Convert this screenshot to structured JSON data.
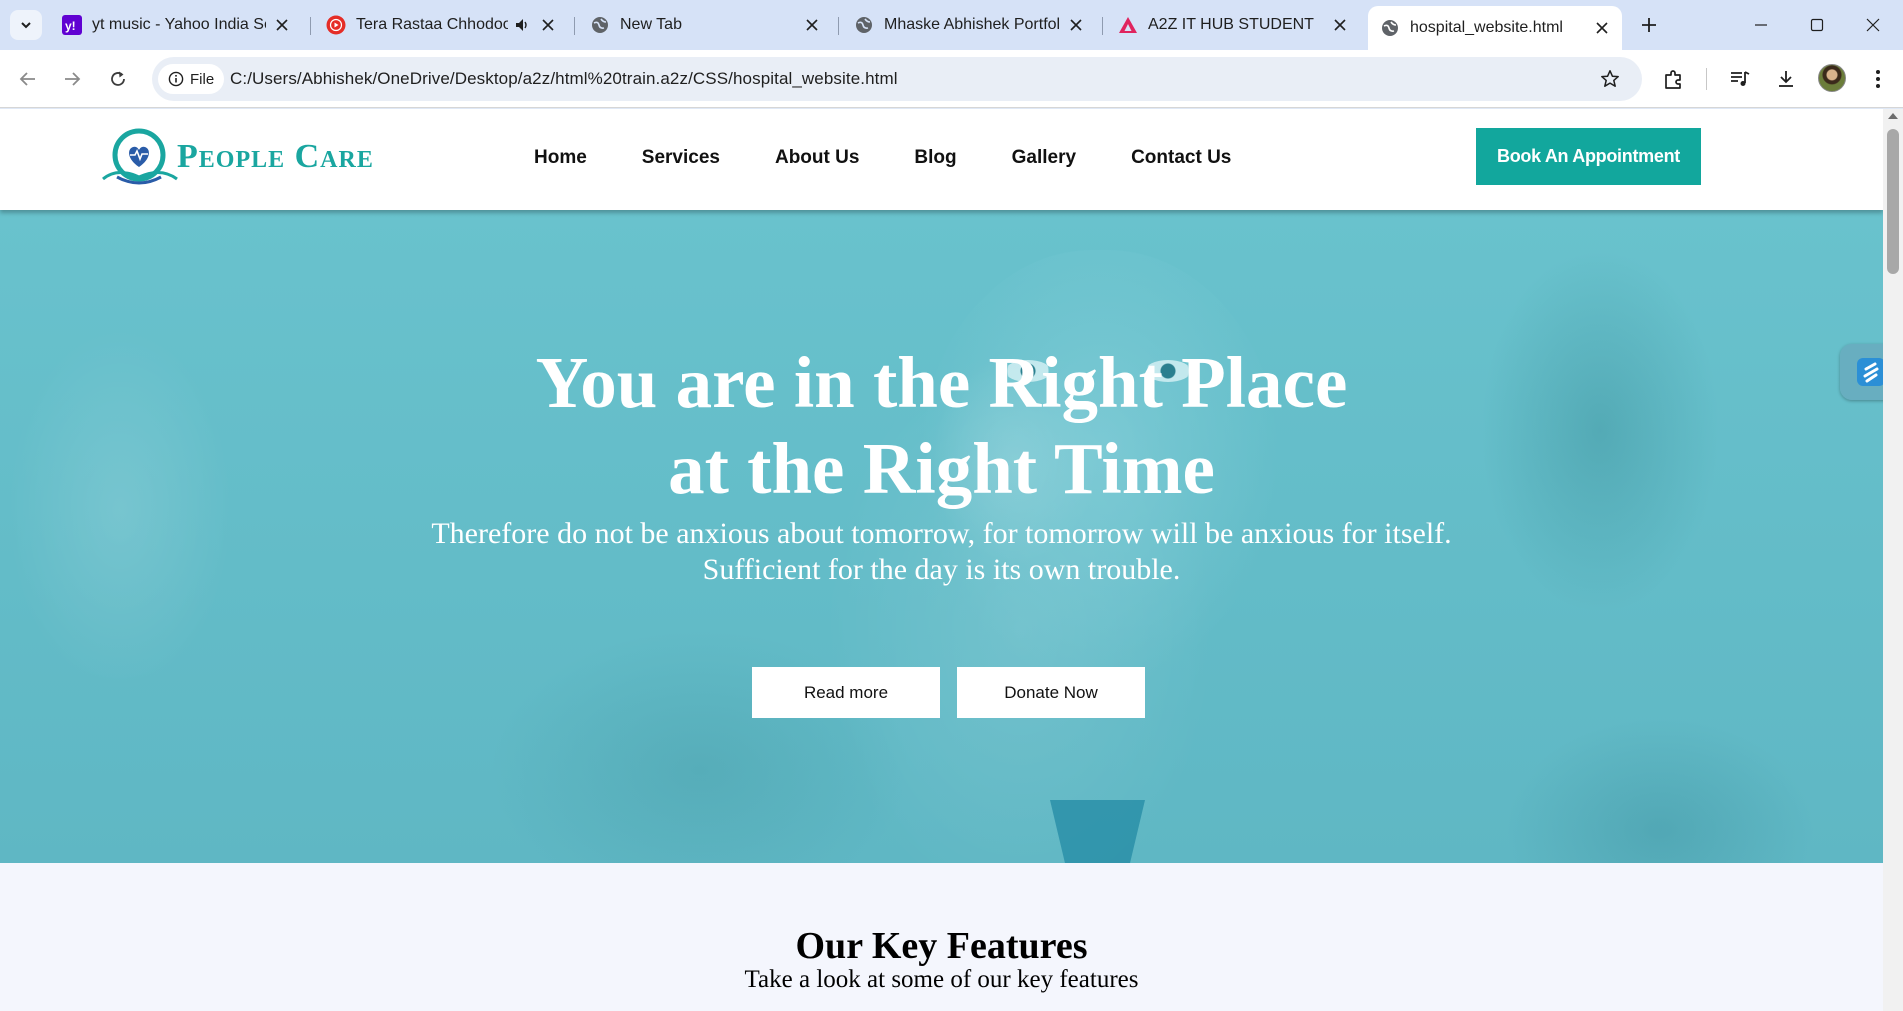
{
  "browser": {
    "tabs": [
      {
        "title": "yt music - Yahoo India Sea",
        "icon": "yahoo-icon",
        "active": false
      },
      {
        "title": "Tera Rastaa Chhodoon",
        "icon": "youtube-icon",
        "audible": true,
        "active": false
      },
      {
        "title": "New Tab",
        "icon": "globe-icon",
        "active": false
      },
      {
        "title": "Mhaske Abhishek Portfolio",
        "icon": "globe-icon",
        "active": false
      },
      {
        "title": "A2Z IT HUB STUDENT",
        "icon": "a2z-icon",
        "active": false
      },
      {
        "title": "hospital_website.html",
        "icon": "globe-icon",
        "active": true
      }
    ],
    "site_chip_label": "File",
    "url": "C:/Users/Abhishek/OneDrive/Desktop/a2z/html%20train.a2z/CSS/hospital_website.html"
  },
  "site": {
    "logo_text": "People Care",
    "nav": [
      "Home",
      "Services",
      "About Us",
      "Blog",
      "Gallery",
      "Contact Us"
    ],
    "book_button": "Book An Appointment"
  },
  "hero": {
    "title_line1": "You are in the Right Place",
    "title_line2": "at the Right Time",
    "subtitle_line1": "Therefore do not be anxious about tomorrow, for tomorrow will be anxious for itself.",
    "subtitle_line2": "Sufficient for the day is its own trouble.",
    "read_more": "Read more",
    "donate": "Donate Now"
  },
  "features": {
    "title": "Our Key Features",
    "subtitle": "Take a look at some of our key features"
  },
  "colors": {
    "brand_teal": "#12a79d",
    "hero_overlay": "#66c0cb",
    "tab_strip": "#d6e2f7"
  }
}
